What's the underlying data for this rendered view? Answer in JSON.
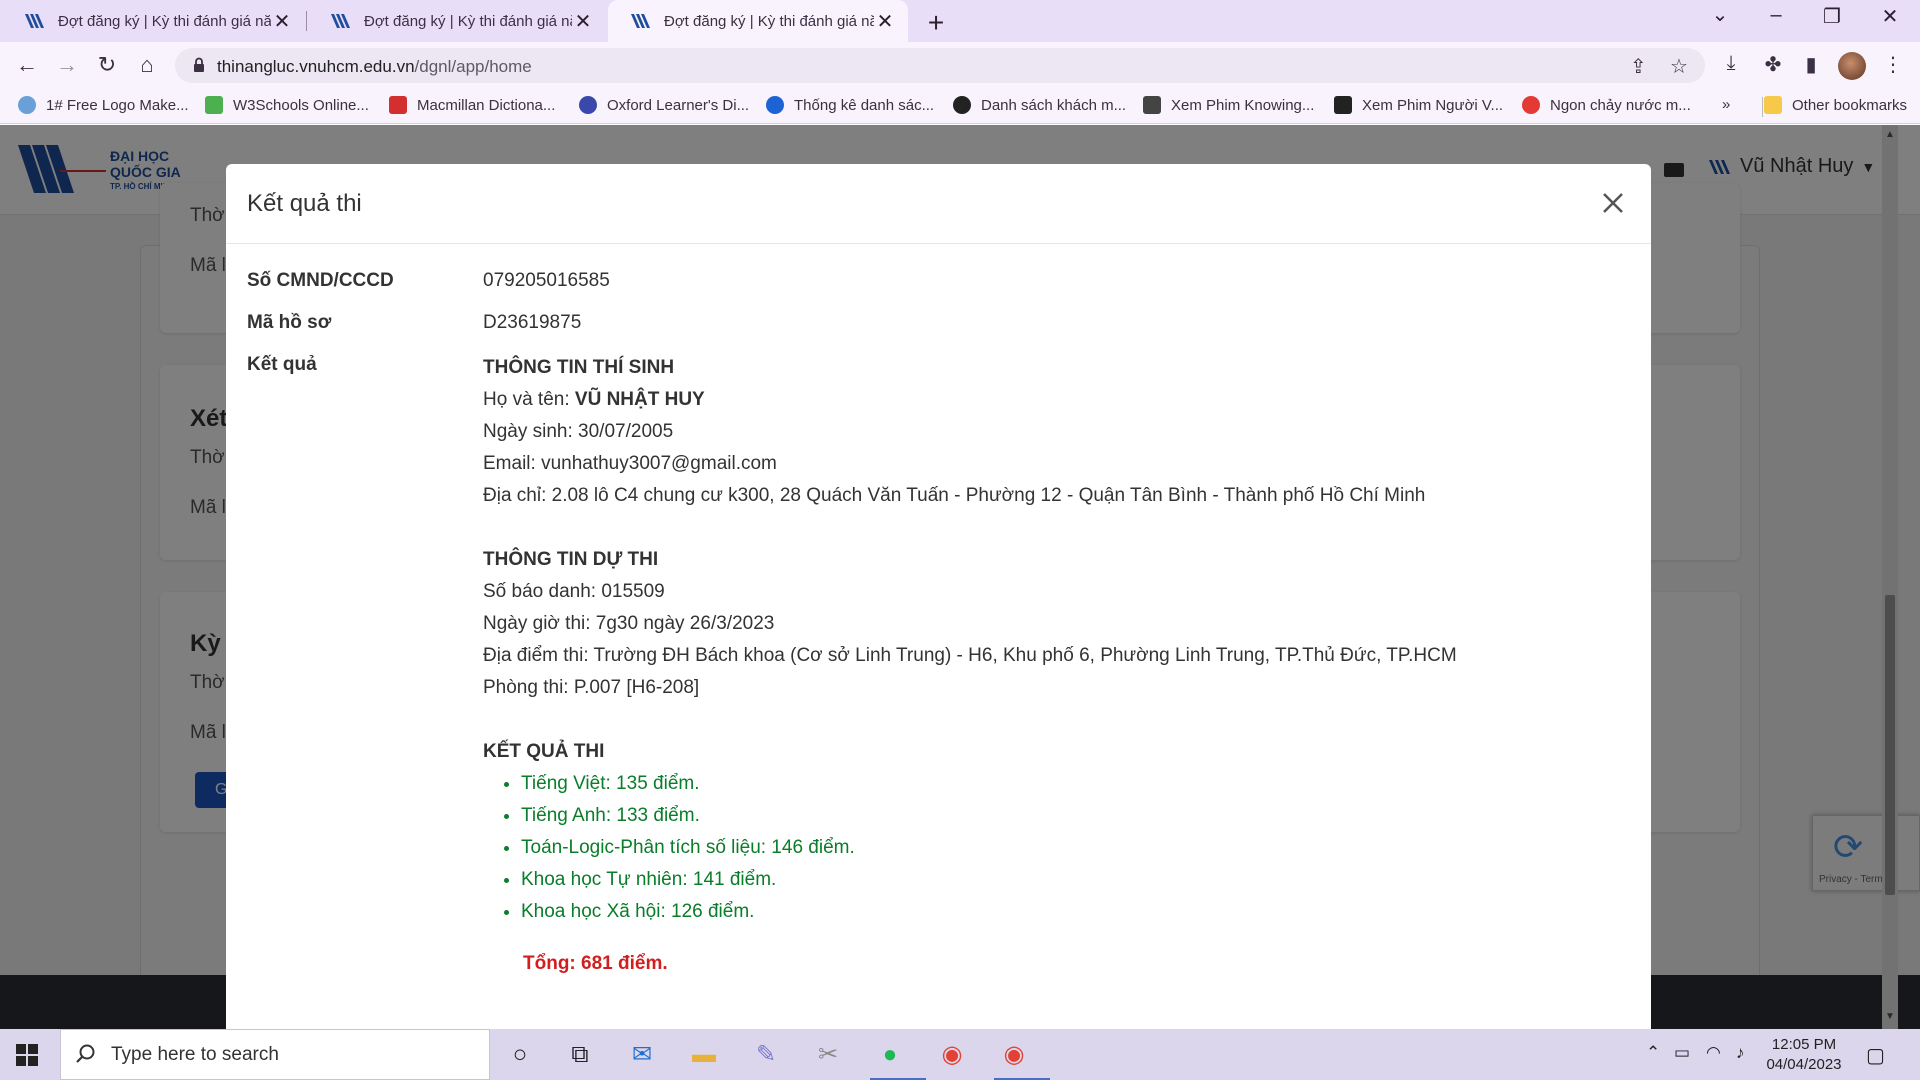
{
  "browser": {
    "tabs": [
      {
        "title": "Đợt đăng ký | Kỳ thi đánh giá năng lực"
      },
      {
        "title": "Đợt đăng ký | Kỳ thi đánh giá năng lực"
      },
      {
        "title": "Đợt đăng ký | Kỳ thi đánh giá năng lực"
      }
    ],
    "url_host": "thinangluc.vnuhcm.edu.vn",
    "url_path": "/dgnl/app/home",
    "bookmarks": [
      {
        "label": "1# Free Logo Make...",
        "icon": "logo-maker-icon",
        "color": "#6aa0d8"
      },
      {
        "label": "W3Schools Online...",
        "icon": "w3schools-icon",
        "color": "#4caf50"
      },
      {
        "label": "Macmillan Dictiona...",
        "icon": "macmillan-icon",
        "color": "#d32f2f"
      },
      {
        "label": "Oxford Learner's Di...",
        "icon": "oxford-icon",
        "color": "#3949ab"
      },
      {
        "label": "Thống kê danh sác...",
        "icon": "r-icon",
        "color": "#1e63d6"
      },
      {
        "label": "Danh sách khách m...",
        "icon": "globe-icon",
        "color": "#222222"
      },
      {
        "label": "Xem Phim Knowing...",
        "icon": "film-icon",
        "color": "#444444"
      },
      {
        "label": "Xem Phim Người V...",
        "icon": "tv-icon",
        "color": "#222222"
      },
      {
        "label": "Ngon chảy nước m...",
        "icon": "channel-14-icon",
        "color": "#e53935"
      }
    ],
    "bookmarks_more": "»",
    "other_bookmarks": "Other bookmarks"
  },
  "site": {
    "logo_line1": "ĐẠI HỌC",
    "logo_line2": "QUỐC GIA",
    "logo_line3": "TP. HỒ CHÍ MINH",
    "user_name": "Vũ Nhật Huy",
    "bg_fragments": [
      "Thờ",
      "Mã l",
      "Xét",
      "Thờ",
      "Mã l",
      "Kỳ t",
      "Thờ",
      "Mã l",
      "G"
    ]
  },
  "modal": {
    "title": "Kết quả thi",
    "id_label": "Số CMND/CCCD",
    "id_value": "079205016585",
    "file_label": "Mã hồ sơ",
    "file_value": "D23619875",
    "result_label": "Kết quả",
    "candidate": {
      "heading": "THÔNG TIN THÍ SINH",
      "name_label": "Họ và tên: ",
      "name": "VŨ NHẬT HUY",
      "dob": "Ngày sinh: 30/07/2005",
      "email": "Email: vunhathuy3007@gmail.com",
      "address": "Địa chỉ: 2.08 lô C4 chung cư k300, 28 Quách Văn Tuấn - Phường 12 - Quận Tân Bình - Thành phố Hồ Chí Minh"
    },
    "exam": {
      "heading": "THÔNG TIN DỰ THI",
      "sbd": "Số báo danh: 015509",
      "time": "Ngày giờ thi: 7g30 ngày 26/3/2023",
      "place": "Địa điểm thi: Trường ĐH Bách khoa (Cơ sở Linh Trung) - H6, Khu phố 6, Phường Linh Trung, TP.Thủ Đức, TP.HCM",
      "room": "Phòng thi: P.007 [H6-208]"
    },
    "scores": {
      "heading": "KẾT QUẢ THI",
      "items": [
        "Tiếng Việt: 135 điểm.",
        "Tiếng Anh: 133 điểm.",
        "Toán-Logic-Phân tích số liệu: 146 điểm.",
        "Khoa học Tự nhiên: 141 điểm.",
        "Khoa học Xã hội: 126 điểm."
      ],
      "total": "Tổng: 681 điểm.",
      "color_pass": "#0a7d2a",
      "color_total": "#d11f1f"
    }
  },
  "recaptcha": {
    "text": "Privacy - Terms"
  },
  "taskbar": {
    "search_placeholder": "Type here to search",
    "time": "12:05 PM",
    "date": "04/04/2023"
  }
}
